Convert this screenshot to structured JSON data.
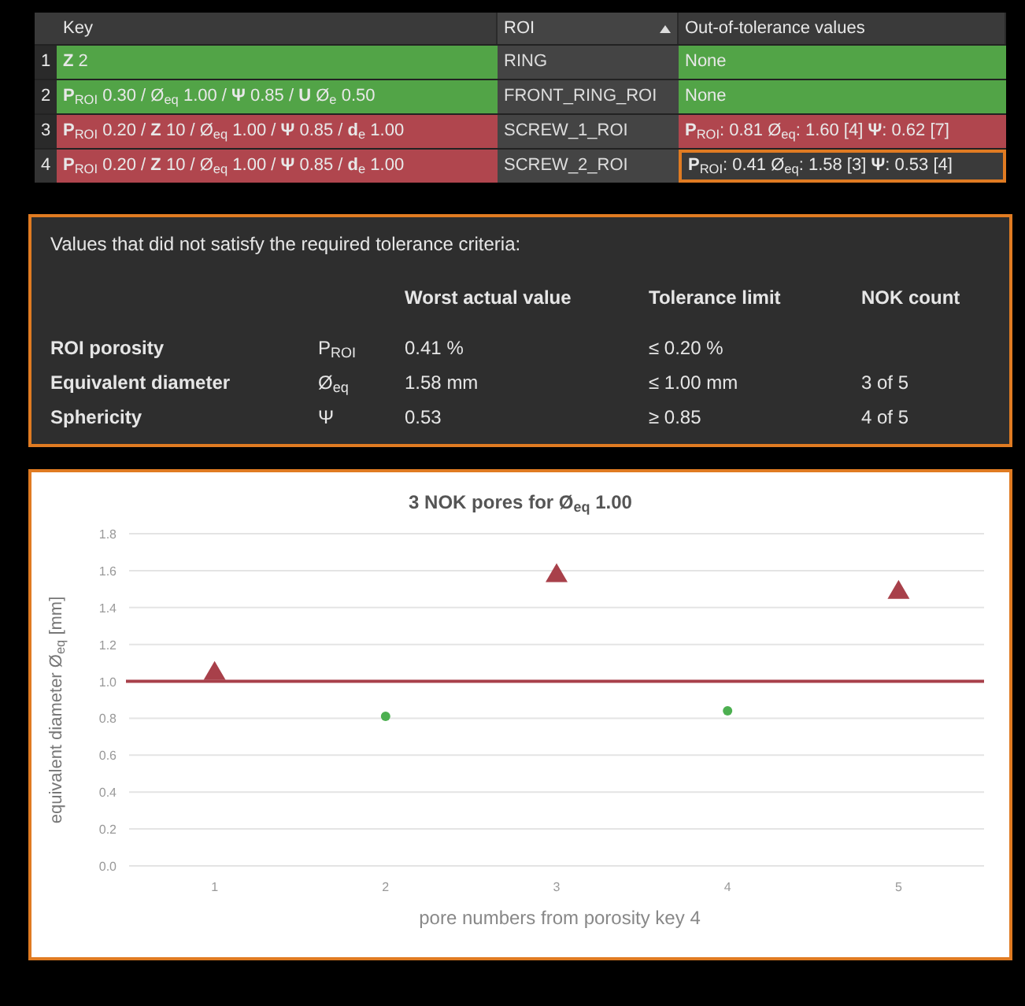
{
  "table": {
    "columns": [
      {
        "label": "Key",
        "sorted": false
      },
      {
        "label": "ROI",
        "sorted": true
      },
      {
        "label": "Out-of-tolerance values",
        "sorted": false
      }
    ],
    "rows": [
      {
        "number": "1",
        "key": "**Z** 2",
        "roi": "RING",
        "values": "None",
        "color": "#52a447",
        "selected": false
      },
      {
        "number": "2",
        "key": "**P**$_{ROI}$ 0.30 / Ø$_{eq}$ 1.00 / **Ψ** 0.85 / **U** Ø$_{e}$ 0.50",
        "roi": "FRONT_RING_ROI",
        "values": "None",
        "color": "#52a447",
        "selected": false
      },
      {
        "number": "3",
        "key": "**P**$_{ROI}$ 0.20 / **Z** 10 / Ø$_{eq}$ 1.00 / **Ψ** 0.85 / **d**$_{e}$ 1.00",
        "roi": "SCREW_1_ROI",
        "values": "**P**$_{ROI}$: 0.81 Ø$_{eq}$: 1.60 [4] **Ψ**: 0.62 [7]",
        "color": "#b0464e",
        "selected": false
      },
      {
        "number": "4",
        "key": "**P**$_{ROI}$ 0.20 / **Z** 10 / Ø$_{eq}$ 1.00 / **Ψ** 0.85 / **d**$_{e}$ 1.00",
        "roi": "SCREW_2_ROI",
        "values": "**P**$_{ROI}$: 0.41 Ø$_{eq}$: 1.58 [3] **Ψ**: 0.53 [4]",
        "color": "#b0464e",
        "selected": true
      }
    ]
  },
  "summary": {
    "heading": "Values that did not satisfy the required tolerance criteria:",
    "columns": [
      "Worst actual value",
      "Tolerance limit",
      "NOK count"
    ],
    "rows": [
      {
        "label": "ROI porosity",
        "symbol": "P$_{ROI}$",
        "worst": "0.41 %",
        "limit": "≤ 0.20 %"
      },
      {
        "label": "Equivalent diameter",
        "symbol": "Ø$_{eq}$",
        "worst": "1.58 mm",
        "limit": "≤ 1.00 mm",
        "count": "3 of 5"
      },
      {
        "label": "Sphericity",
        "symbol": "Ψ",
        "worst": "0.53",
        "limit": "≥ 0.85",
        "count": "4 of 5"
      }
    ]
  },
  "chart": {
    "chart_data": {
      "type": "scatter",
      "title": "3 NOK pores for Ø$_{eq}$ 1.00",
      "xlabel": "pore numbers from porosity key 4",
      "ylabel": "equivalent diameter Ø$_{eq}$ [mm]",
      "categories": [
        "1",
        "2",
        "3",
        "4",
        "5"
      ],
      "series": [
        {
          "color": "#a8404a",
          "marker": "triangle",
          "values": [
            1.05,
            null,
            1.58,
            null,
            1.49
          ]
        },
        {
          "color": "#4caf50",
          "marker": "circle",
          "values": [
            null,
            0.81,
            null,
            0.84,
            null
          ]
        }
      ],
      "ylim": [
        0,
        1.8
      ],
      "yticks": [
        {
          "value": 0,
          "label": "0.0"
        },
        {
          "value": 0.2,
          "label": "0.2"
        },
        {
          "value": 0.4,
          "label": "0.4"
        },
        {
          "value": 0.6,
          "label": "0.6"
        },
        {
          "value": 0.8,
          "label": "0.8"
        },
        {
          "value": 1,
          "label": "1.0"
        },
        {
          "value": 1.2,
          "label": "1.2"
        },
        {
          "value": 1.4,
          "label": "1.4"
        },
        {
          "value": 1.6,
          "label": "1.6"
        },
        {
          "value": 1.8,
          "label": "1.8"
        }
      ],
      "grid": true,
      "ref_lines": [
        {
          "axis": "y",
          "value": 1.0,
          "color": "#a8404a"
        }
      ]
    }
  }
}
